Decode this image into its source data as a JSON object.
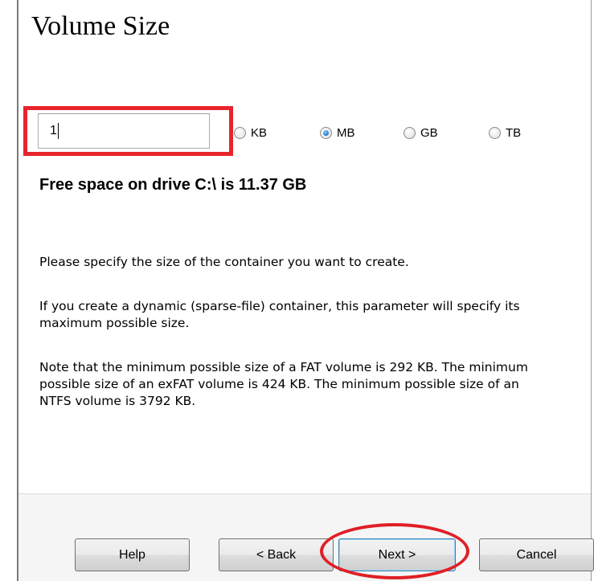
{
  "page": {
    "title": "Volume Size"
  },
  "size_input": {
    "value": "1"
  },
  "units": [
    {
      "label": "KB",
      "checked": false
    },
    {
      "label": "MB",
      "checked": true
    },
    {
      "label": "GB",
      "checked": false
    },
    {
      "label": "TB",
      "checked": false
    }
  ],
  "free_space_text": "Free space on drive C:\\ is 11.37 GB",
  "info": {
    "specify_size": "Please specify the size of the container you want to create.",
    "dynamic_note": "If you create a dynamic (sparse-file) container, this parameter will specify its maximum possible size.",
    "min_size_note": "Note that the minimum possible size of a FAT volume is 292 KB. The minimum possible size of an exFAT volume is 424 KB. The minimum possible size of an NTFS volume is 3792 KB."
  },
  "buttons": {
    "help": "Help",
    "back": "< Back",
    "next": "Next >",
    "cancel": "Cancel"
  },
  "annotations": {
    "highlight_color": "#e8242c"
  }
}
